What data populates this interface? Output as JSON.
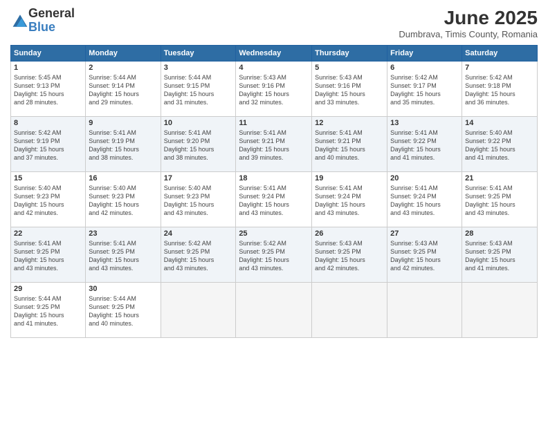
{
  "header": {
    "logo_general": "General",
    "logo_blue": "Blue",
    "month_title": "June 2025",
    "location": "Dumbrava, Timis County, Romania"
  },
  "days_of_week": [
    "Sunday",
    "Monday",
    "Tuesday",
    "Wednesday",
    "Thursday",
    "Friday",
    "Saturday"
  ],
  "weeks": [
    [
      {
        "day": "1",
        "info": "Sunrise: 5:45 AM\nSunset: 9:13 PM\nDaylight: 15 hours\nand 28 minutes."
      },
      {
        "day": "2",
        "info": "Sunrise: 5:44 AM\nSunset: 9:14 PM\nDaylight: 15 hours\nand 29 minutes."
      },
      {
        "day": "3",
        "info": "Sunrise: 5:44 AM\nSunset: 9:15 PM\nDaylight: 15 hours\nand 31 minutes."
      },
      {
        "day": "4",
        "info": "Sunrise: 5:43 AM\nSunset: 9:16 PM\nDaylight: 15 hours\nand 32 minutes."
      },
      {
        "day": "5",
        "info": "Sunrise: 5:43 AM\nSunset: 9:16 PM\nDaylight: 15 hours\nand 33 minutes."
      },
      {
        "day": "6",
        "info": "Sunrise: 5:42 AM\nSunset: 9:17 PM\nDaylight: 15 hours\nand 35 minutes."
      },
      {
        "day": "7",
        "info": "Sunrise: 5:42 AM\nSunset: 9:18 PM\nDaylight: 15 hours\nand 36 minutes."
      }
    ],
    [
      {
        "day": "8",
        "info": "Sunrise: 5:42 AM\nSunset: 9:19 PM\nDaylight: 15 hours\nand 37 minutes."
      },
      {
        "day": "9",
        "info": "Sunrise: 5:41 AM\nSunset: 9:19 PM\nDaylight: 15 hours\nand 38 minutes."
      },
      {
        "day": "10",
        "info": "Sunrise: 5:41 AM\nSunset: 9:20 PM\nDaylight: 15 hours\nand 38 minutes."
      },
      {
        "day": "11",
        "info": "Sunrise: 5:41 AM\nSunset: 9:21 PM\nDaylight: 15 hours\nand 39 minutes."
      },
      {
        "day": "12",
        "info": "Sunrise: 5:41 AM\nSunset: 9:21 PM\nDaylight: 15 hours\nand 40 minutes."
      },
      {
        "day": "13",
        "info": "Sunrise: 5:41 AM\nSunset: 9:22 PM\nDaylight: 15 hours\nand 41 minutes."
      },
      {
        "day": "14",
        "info": "Sunrise: 5:40 AM\nSunset: 9:22 PM\nDaylight: 15 hours\nand 41 minutes."
      }
    ],
    [
      {
        "day": "15",
        "info": "Sunrise: 5:40 AM\nSunset: 9:23 PM\nDaylight: 15 hours\nand 42 minutes."
      },
      {
        "day": "16",
        "info": "Sunrise: 5:40 AM\nSunset: 9:23 PM\nDaylight: 15 hours\nand 42 minutes."
      },
      {
        "day": "17",
        "info": "Sunrise: 5:40 AM\nSunset: 9:23 PM\nDaylight: 15 hours\nand 43 minutes."
      },
      {
        "day": "18",
        "info": "Sunrise: 5:41 AM\nSunset: 9:24 PM\nDaylight: 15 hours\nand 43 minutes."
      },
      {
        "day": "19",
        "info": "Sunrise: 5:41 AM\nSunset: 9:24 PM\nDaylight: 15 hours\nand 43 minutes."
      },
      {
        "day": "20",
        "info": "Sunrise: 5:41 AM\nSunset: 9:24 PM\nDaylight: 15 hours\nand 43 minutes."
      },
      {
        "day": "21",
        "info": "Sunrise: 5:41 AM\nSunset: 9:25 PM\nDaylight: 15 hours\nand 43 minutes."
      }
    ],
    [
      {
        "day": "22",
        "info": "Sunrise: 5:41 AM\nSunset: 9:25 PM\nDaylight: 15 hours\nand 43 minutes."
      },
      {
        "day": "23",
        "info": "Sunrise: 5:41 AM\nSunset: 9:25 PM\nDaylight: 15 hours\nand 43 minutes."
      },
      {
        "day": "24",
        "info": "Sunrise: 5:42 AM\nSunset: 9:25 PM\nDaylight: 15 hours\nand 43 minutes."
      },
      {
        "day": "25",
        "info": "Sunrise: 5:42 AM\nSunset: 9:25 PM\nDaylight: 15 hours\nand 43 minutes."
      },
      {
        "day": "26",
        "info": "Sunrise: 5:43 AM\nSunset: 9:25 PM\nDaylight: 15 hours\nand 42 minutes."
      },
      {
        "day": "27",
        "info": "Sunrise: 5:43 AM\nSunset: 9:25 PM\nDaylight: 15 hours\nand 42 minutes."
      },
      {
        "day": "28",
        "info": "Sunrise: 5:43 AM\nSunset: 9:25 PM\nDaylight: 15 hours\nand 41 minutes."
      }
    ],
    [
      {
        "day": "29",
        "info": "Sunrise: 5:44 AM\nSunset: 9:25 PM\nDaylight: 15 hours\nand 41 minutes."
      },
      {
        "day": "30",
        "info": "Sunrise: 5:44 AM\nSunset: 9:25 PM\nDaylight: 15 hours\nand 40 minutes."
      },
      {
        "day": "",
        "info": ""
      },
      {
        "day": "",
        "info": ""
      },
      {
        "day": "",
        "info": ""
      },
      {
        "day": "",
        "info": ""
      },
      {
        "day": "",
        "info": ""
      }
    ]
  ]
}
